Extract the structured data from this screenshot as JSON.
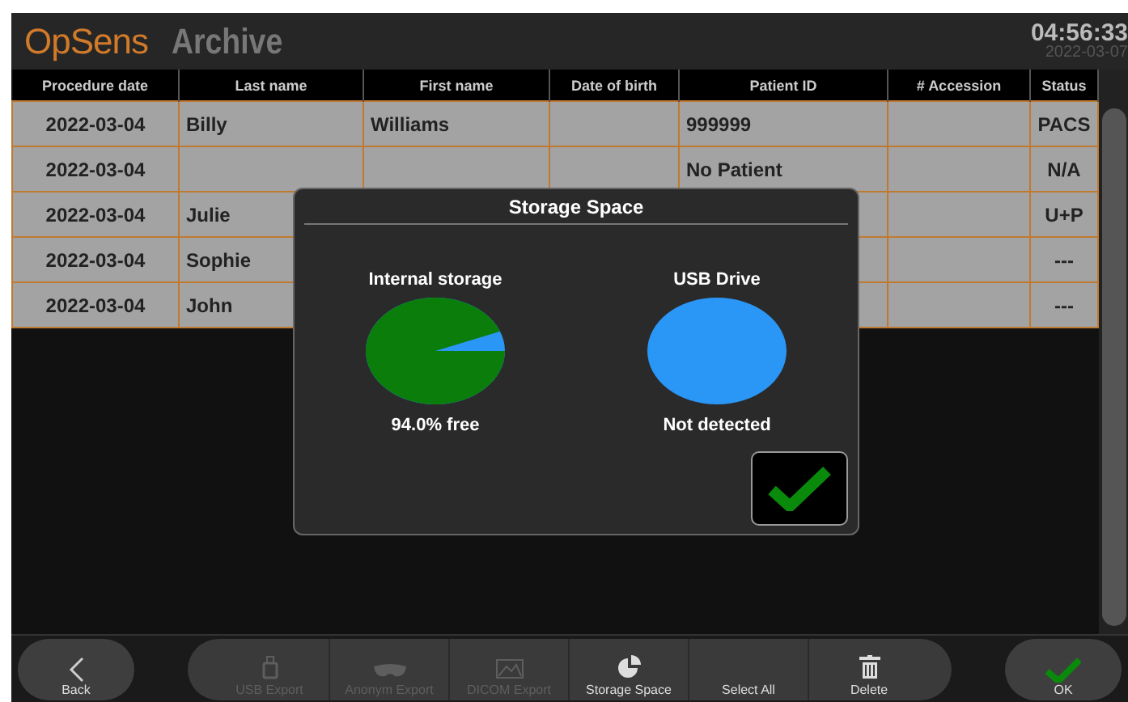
{
  "header": {
    "logo": "OpSens",
    "title": "Archive",
    "time": "04:56:33",
    "date": "2022-03-07"
  },
  "table": {
    "columns": [
      "Procedure date",
      "Last name",
      "First name",
      "Date of birth",
      "Patient ID",
      "# Accession",
      "Status"
    ],
    "rows": [
      {
        "procedure_date": "2022-03-04",
        "last_name": "Billy",
        "first_name": "Williams",
        "patient_id": "999999",
        "status": "PACS"
      },
      {
        "procedure_date": "2022-03-04",
        "last_name": "",
        "first_name": "",
        "patient_id": "No Patient",
        "status": "N/A"
      },
      {
        "procedure_date": "2022-03-04",
        "last_name": "Julie",
        "first_name": "",
        "patient_id": "",
        "status": "U+P"
      },
      {
        "procedure_date": "2022-03-04",
        "last_name": "Sophie",
        "first_name": "",
        "patient_id": "",
        "status": "---"
      },
      {
        "procedure_date": "2022-03-04",
        "last_name": "John",
        "first_name": "",
        "patient_id": "",
        "status": "---"
      }
    ]
  },
  "dialog": {
    "title": "Storage Space",
    "drives": [
      {
        "kind": "present",
        "name": "Internal storage",
        "level": 0.94,
        "reading": "94.0% free"
      },
      {
        "kind": "absent",
        "name": "USB Drive",
        "reading": "Not detected"
      }
    ]
  },
  "toolbar": {
    "back": "Back",
    "ok": "OK",
    "buttons": [
      {
        "kind": "usb",
        "label": "USB Export",
        "disabled": true
      },
      {
        "kind": "mask",
        "label": "Anonym Export",
        "disabled": true
      },
      {
        "kind": "image",
        "label": "DICOM Export",
        "disabled": true
      },
      {
        "kind": "pie",
        "label": "Storage Space",
        "disabled": false
      },
      {
        "kind": "plain",
        "label": "Select All",
        "disabled": false
      },
      {
        "kind": "trash",
        "label": "Delete",
        "disabled": false
      }
    ]
  }
}
